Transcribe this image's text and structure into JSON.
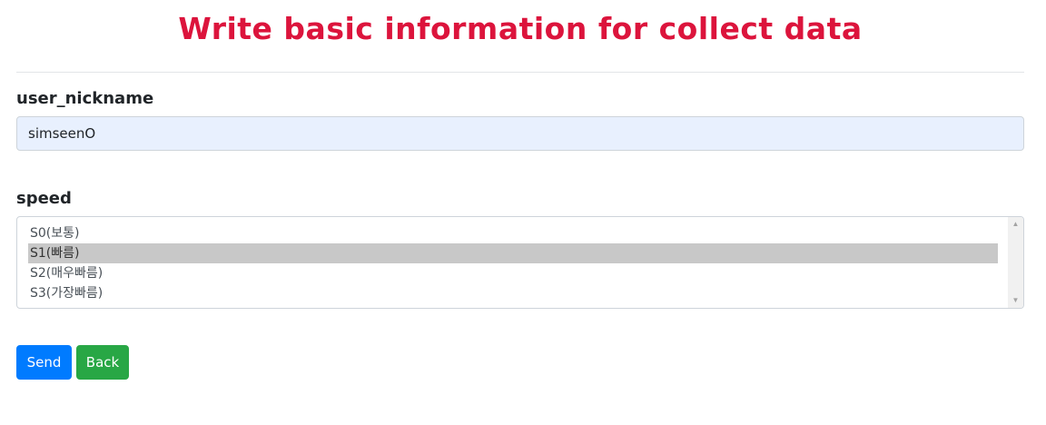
{
  "header": {
    "title": "Write basic information for collect data"
  },
  "form": {
    "nickname": {
      "label": "user_nickname",
      "value": "simseenO"
    },
    "speed": {
      "label": "speed",
      "options": [
        "S0(보통)",
        "S1(빠름)",
        "S2(매우빠름)",
        "S3(가장빠름)"
      ],
      "selected": "S1(빠름)"
    }
  },
  "actions": {
    "send_label": "Send",
    "back_label": "Back"
  },
  "colors": {
    "title": "#dc143c",
    "send_button": "#007bff",
    "back_button": "#28a745",
    "input_autofill": "#e8f0fe",
    "selected_option": "#c8c8c8"
  },
  "icons": {
    "scroll_up": "scroll-up-arrow-icon",
    "scroll_down": "scroll-down-arrow-icon"
  }
}
